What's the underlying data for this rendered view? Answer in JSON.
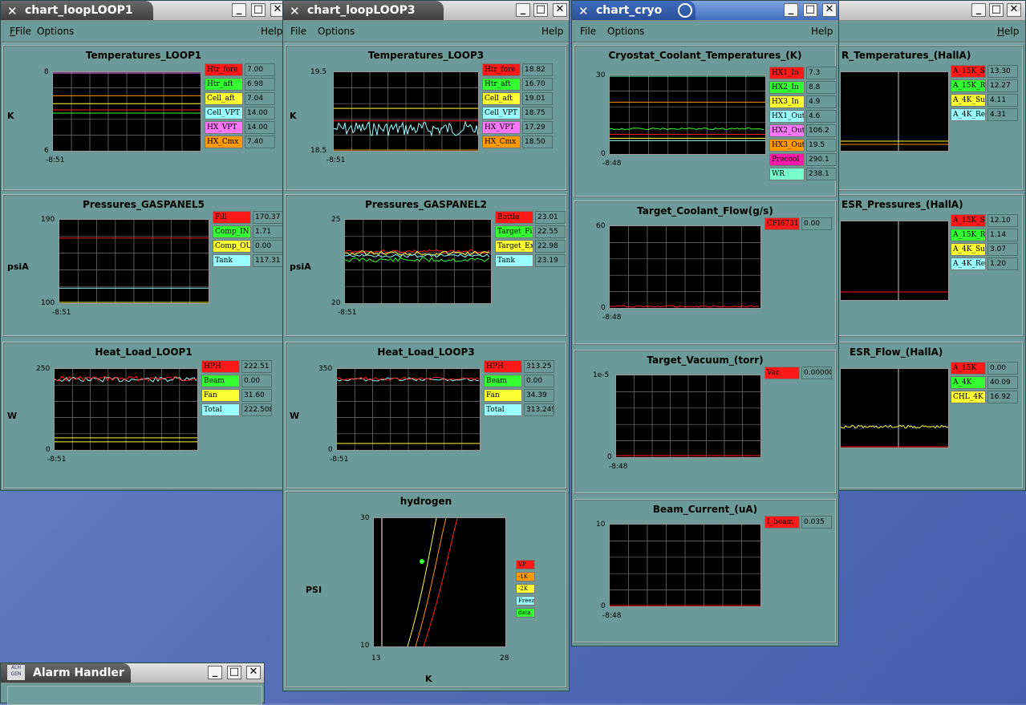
{
  "menus": {
    "file": "File",
    "options": "Options",
    "help": "Help"
  },
  "windows": {
    "loop1": {
      "title": "chart_loopLOOP1"
    },
    "loop3": {
      "title": "chart_loopLOOP3"
    },
    "cryo": {
      "title": "chart_cryo"
    },
    "hallA": {
      "title": ""
    },
    "alarm": {
      "title": "Alarm Handler",
      "logo": "ALH\nGEN"
    }
  },
  "loop1": {
    "temps": {
      "title": "Temperatures_LOOP1",
      "unit": "K",
      "ymax": "8",
      "ymin": "6",
      "time": "-8:51",
      "legend": [
        {
          "name": "Htr_fore",
          "value": "7.00",
          "color": "#ff1a1a"
        },
        {
          "name": "Htr_aft",
          "value": "6.98",
          "color": "#33ff33"
        },
        {
          "name": "Cell_aft",
          "value": "7.04",
          "color": "#ffff33"
        },
        {
          "name": "Cell_VPT",
          "value": "14.00",
          "color": "#99ffff"
        },
        {
          "name": "HX_VPT",
          "value": "14.00",
          "color": "#ff77ff"
        },
        {
          "name": "HX_Cmx",
          "value": "7.40",
          "color": "#ff9900"
        }
      ]
    },
    "press": {
      "title": "Pressures_GASPANEL5",
      "unit": "psiA",
      "ymax": "190",
      "ymin": "100",
      "time": "-8:51",
      "legend": [
        {
          "name": "Fill",
          "value": "170.37",
          "color": "#ff1a1a"
        },
        {
          "name": "Comp_IN",
          "value": "1.71",
          "color": "#33ff33"
        },
        {
          "name": "Comp_OUT",
          "value": "0.00",
          "color": "#ffff33"
        },
        {
          "name": "Tank",
          "value": "117.31",
          "color": "#99ffff"
        }
      ]
    },
    "heat": {
      "title": "Heat_Load_LOOP1",
      "unit": "W",
      "ymax": "250",
      "ymin": "0",
      "time": "-8:51",
      "legend": [
        {
          "name": "HPH",
          "value": "222.51",
          "color": "#ff1a1a"
        },
        {
          "name": "Beam",
          "value": "0.00",
          "color": "#33ff33"
        },
        {
          "name": "Fan",
          "value": "31.60",
          "color": "#ffff33"
        },
        {
          "name": "Total",
          "value": "222.508",
          "color": "#99ffff"
        }
      ]
    }
  },
  "loop3": {
    "temps": {
      "title": "Temperatures_LOOP3",
      "unit": "K",
      "ymax": "19.5",
      "ymin": "18.5",
      "time": "-8:51",
      "legend": [
        {
          "name": "Htr_fore",
          "value": "18.82",
          "color": "#ff1a1a"
        },
        {
          "name": "Htr_aft",
          "value": "16.70",
          "color": "#33ff33"
        },
        {
          "name": "Cell_aft",
          "value": "19.01",
          "color": "#ffff33"
        },
        {
          "name": "Cell_VPT",
          "value": "18.75",
          "color": "#99ffff"
        },
        {
          "name": "HX_VPT",
          "value": "17.29",
          "color": "#ff77ff"
        },
        {
          "name": "HX_Cmx",
          "value": "18.50",
          "color": "#ff9900"
        }
      ]
    },
    "press": {
      "title": "Pressures_GASPANEL2",
      "unit": "psiA",
      "ymax": "25",
      "ymin": "20",
      "time": "-8:51",
      "legend": [
        {
          "name": "Bottle",
          "value": "23.01",
          "color": "#ff1a1a"
        },
        {
          "name": "Target_Fill",
          "value": "22.55",
          "color": "#33ff33"
        },
        {
          "name": "Target_Exh",
          "value": "22.98",
          "color": "#ffff33"
        },
        {
          "name": "Tank",
          "value": "23.19",
          "color": "#99ffff"
        }
      ]
    },
    "heat": {
      "title": "Heat_Load_LOOP3",
      "unit": "W",
      "ymax": "350",
      "ymin": "0",
      "time": "-8:51",
      "legend": [
        {
          "name": "HPH",
          "value": "313.25",
          "color": "#ff1a1a"
        },
        {
          "name": "Beam",
          "value": "0.00",
          "color": "#33ff33"
        },
        {
          "name": "Fan",
          "value": "34.39",
          "color": "#ffff33"
        },
        {
          "name": "Total",
          "value": "313.249",
          "color": "#99ffff"
        }
      ]
    },
    "hydrogen": {
      "title": "hydrogen",
      "ylabel": "PSI",
      "xlabel": "K",
      "ymax": "30",
      "ymin": "10",
      "xmin": "13",
      "xmax": "28",
      "legend": [
        {
          "name": "VP",
          "color": "#ff1a1a"
        },
        {
          "name": "-1K",
          "color": "#ff9900"
        },
        {
          "name": "-2K",
          "color": "#ffff33"
        },
        {
          "name": "Freeze",
          "color": "#99ffff"
        },
        {
          "name": "data",
          "color": "#33ff33"
        }
      ]
    }
  },
  "cryo": {
    "temps": {
      "title": "Cryostat_Coolant_Temperatures_(K)",
      "ymax": "30",
      "ymin": "0",
      "time": "-8:48",
      "legend": [
        {
          "name": "HX1_In",
          "value": "7.3",
          "color": "#ff1a1a"
        },
        {
          "name": "HX2_In",
          "value": "8.8",
          "color": "#33ff33"
        },
        {
          "name": "HX3_In",
          "value": "4.9",
          "color": "#ffff33"
        },
        {
          "name": "HX1_Out",
          "value": "4.6",
          "color": "#99ffff"
        },
        {
          "name": "HX2_Out",
          "value": "106.2",
          "color": "#ff77ff"
        },
        {
          "name": "HX3_Out",
          "value": "19.5",
          "color": "#ff9900"
        },
        {
          "name": "Precool",
          "value": "290.1",
          "color": "#ff1aa8"
        },
        {
          "name": "WR",
          "value": "238.1",
          "color": "#77ffcc"
        }
      ]
    },
    "flow": {
      "title": "Target_Coolant_Flow(g/s)",
      "ymax": "60",
      "ymin": "0",
      "time": "-8:48",
      "legend": [
        {
          "name": "CFI6731A",
          "value": "0.00",
          "color": "#ff1a1a"
        }
      ]
    },
    "vacuum": {
      "title": "Target_Vacuum_(torr)",
      "ymax": "1e-5",
      "ymin": "0",
      "time": "-8:48",
      "legend": [
        {
          "name": "Vac",
          "value": "0.0000004",
          "color": "#ff1a1a"
        }
      ]
    },
    "beam": {
      "title": "Beam_Current_(uA)",
      "ymax": "10",
      "ymin": "0",
      "time": "-8:48",
      "legend": [
        {
          "name": "I_beam",
          "value": "0.035",
          "color": "#ff1a1a"
        }
      ]
    }
  },
  "hallA": {
    "temps": {
      "title": "R_Temperatures_(HallA)",
      "legend": [
        {
          "name": "A_15K_Sup",
          "value": "13.30",
          "color": "#ff1a1a"
        },
        {
          "name": "A_15K_Ret",
          "value": "12.27",
          "color": "#33ff33"
        },
        {
          "name": "A_4K_Sup",
          "value": "4.11",
          "color": "#ffff33"
        },
        {
          "name": "A_4K_Ret",
          "value": "4.31",
          "color": "#99ffff"
        }
      ]
    },
    "press": {
      "title": "ESR_Pressures_(HallA)",
      "legend": [
        {
          "name": "A_15K_Sup",
          "value": "12.10",
          "color": "#ff1a1a"
        },
        {
          "name": "A_15K_Ret",
          "value": "1.14",
          "color": "#33ff33"
        },
        {
          "name": "A_4K_Sup",
          "value": "3.07",
          "color": "#ffff33"
        },
        {
          "name": "A_4K_Ret",
          "value": "1.20",
          "color": "#99ffff"
        }
      ]
    },
    "flow": {
      "title": "ESR_Flow_(HallA)",
      "legend": [
        {
          "name": "A_15K",
          "value": "0.00",
          "color": "#ff1a1a"
        },
        {
          "name": "A_4K",
          "value": "40.09",
          "color": "#33ff33"
        },
        {
          "name": "CHL_4K",
          "value": "16.92",
          "color": "#ffff33"
        }
      ]
    }
  }
}
